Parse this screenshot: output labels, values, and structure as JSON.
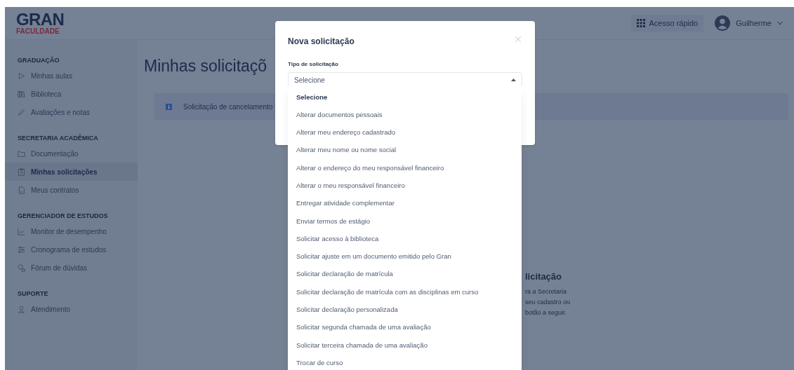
{
  "header": {
    "logo": {
      "title": "GRAN",
      "subtitle": "FACULDADE"
    },
    "quick_access": "Acesso rápido",
    "user": "Guilherme"
  },
  "sidebar": {
    "sections": [
      {
        "title": "GRADUAÇÃO",
        "items": [
          {
            "label": "Minhas aulas",
            "selected": false
          },
          {
            "label": "Biblioteca",
            "selected": false
          },
          {
            "label": "Avaliações e notas",
            "selected": false
          }
        ]
      },
      {
        "title": "SECRETARIA ACADÊMICA",
        "items": [
          {
            "label": "Documentação",
            "selected": false
          },
          {
            "label": "Minhas solicitações",
            "selected": true
          },
          {
            "label": "Meus contratos",
            "selected": false
          }
        ]
      },
      {
        "title": "GERENCIADOR DE ESTUDOS",
        "items": [
          {
            "label": "Monitor de desempenho",
            "selected": false
          },
          {
            "label": "Cronograma de estudos",
            "selected": false
          },
          {
            "label": "Fórum de dúvidas",
            "selected": false
          }
        ]
      },
      {
        "title": "SUPORTE",
        "items": [
          {
            "label": "Atendimento",
            "selected": false
          }
        ]
      }
    ]
  },
  "main": {
    "title": "Minhas solicitaçõ",
    "banner": "Solicitação de cancelamento",
    "empty_title": "licitação",
    "empty_lines": [
      "ra a Secretaria",
      "seu cadastro ou",
      "botão a seguir."
    ]
  },
  "modal": {
    "title": "Nova solicitação",
    "field_label": "Tipo de solicitação",
    "value": "Selecione",
    "expanded": true,
    "options": [
      {
        "label": "Selecione",
        "selected": true
      },
      {
        "label": "Alterar documentos pessoais",
        "selected": false
      },
      {
        "label": "Alterar meu endereço cadastrado",
        "selected": false
      },
      {
        "label": "Alterar meu nome ou nome social",
        "selected": false
      },
      {
        "label": "Alterar o endereço do meu responsável financeiro",
        "selected": false
      },
      {
        "label": "Alterar o meu responsável financeiro",
        "selected": false
      },
      {
        "label": "Entregar atividade complementar",
        "selected": false
      },
      {
        "label": "Enviar termos de estágio",
        "selected": false
      },
      {
        "label": "Solicitar acesso à biblioteca",
        "selected": false
      },
      {
        "label": "Solicitar ajuste em um documento emitido pelo Gran",
        "selected": false
      },
      {
        "label": "Solicitar declaração de matrícula",
        "selected": false
      },
      {
        "label": "Solicitar declaração de matrícula com as disciplinas em curso",
        "selected": false
      },
      {
        "label": "Solicitar declaração personalizada",
        "selected": false
      },
      {
        "label": "Solicitar segunda chamada de uma avaliação",
        "selected": false
      },
      {
        "label": "Solicitar terceira chamada de uma avaliação",
        "selected": false
      },
      {
        "label": "Trocar de curso",
        "selected": false
      }
    ]
  }
}
